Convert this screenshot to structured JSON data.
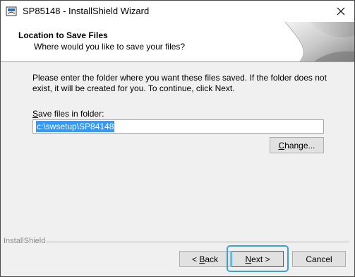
{
  "window": {
    "title": "SP85148 - InstallShield Wizard",
    "icon": "installer-icon",
    "close_icon": "close-icon"
  },
  "header": {
    "title": "Location to Save Files",
    "subtitle": "Where would you like to save your files?"
  },
  "body": {
    "instructions": "Please enter the folder where you want these files saved.  If the folder does not exist, it will be created for you.   To continue, click Next.",
    "folder_label_prefix": "S",
    "folder_label_rest": "ave files in folder:",
    "folder_value": "c:\\swsetup\\SP84148",
    "change_prefix": "C",
    "change_rest": "hange..."
  },
  "footer": {
    "brand": "InstallShield",
    "back_arrow": "< ",
    "back_prefix": "B",
    "back_rest": "ack",
    "next_prefix": "N",
    "next_rest": "ext >",
    "cancel_label": "Cancel"
  },
  "colors": {
    "selection": "#3399ff",
    "highlight_ring": "#3aa0d6",
    "default_button_border": "#0078d7"
  }
}
